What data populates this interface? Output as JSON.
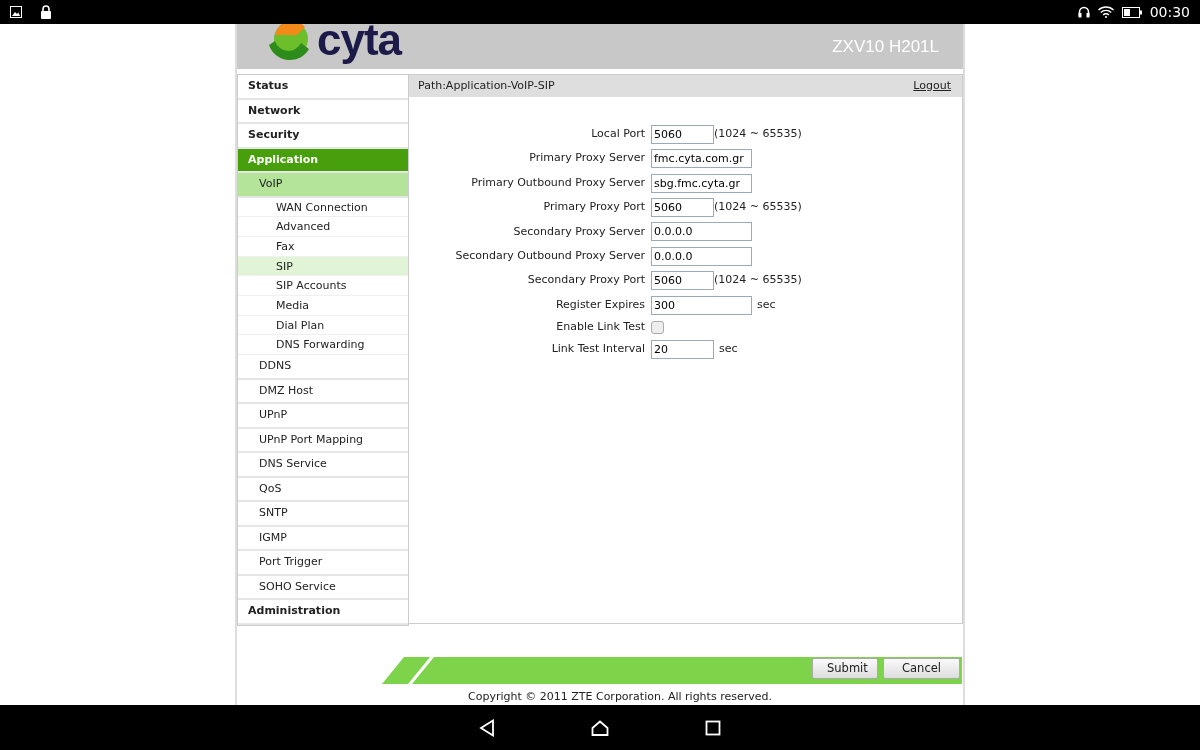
{
  "status_bar": {
    "time": "00:30"
  },
  "header": {
    "logo_text": "cyta",
    "model": "ZXV10 H201L"
  },
  "sidebar": {
    "items": [
      {
        "label": "Status",
        "selected": false
      },
      {
        "label": "Network",
        "selected": false
      },
      {
        "label": "Security",
        "selected": false
      },
      {
        "label": "Application",
        "selected": true,
        "children": [
          {
            "label": "VoIP",
            "selected": true,
            "children": [
              {
                "label": "WAN Connection",
                "selected": false
              },
              {
                "label": "Advanced",
                "selected": false
              },
              {
                "label": "Fax",
                "selected": false
              },
              {
                "label": "SIP",
                "selected": true
              },
              {
                "label": "SIP Accounts",
                "selected": false
              },
              {
                "label": "Media",
                "selected": false
              },
              {
                "label": "Dial Plan",
                "selected": false
              },
              {
                "label": "DNS Forwarding",
                "selected": false
              }
            ]
          },
          {
            "label": "DDNS",
            "selected": false
          },
          {
            "label": "DMZ Host",
            "selected": false
          },
          {
            "label": "UPnP",
            "selected": false
          },
          {
            "label": "UPnP Port Mapping",
            "selected": false
          },
          {
            "label": "DNS Service",
            "selected": false
          },
          {
            "label": "QoS",
            "selected": false
          },
          {
            "label": "SNTP",
            "selected": false
          },
          {
            "label": "IGMP",
            "selected": false
          },
          {
            "label": "Port Trigger",
            "selected": false
          },
          {
            "label": "SOHO Service",
            "selected": false
          }
        ]
      },
      {
        "label": "Administration",
        "selected": false
      }
    ]
  },
  "path_bar": {
    "path": "Path:Application-VoIP-SIP",
    "logout": "Logout"
  },
  "form": {
    "fields": [
      {
        "kind": "shortfield",
        "label": "Local Port",
        "value": "5060",
        "hint": "(1024 ~ 65535)"
      },
      {
        "kind": "longfield",
        "label": "Primary Proxy Server",
        "value": "fmc.cyta.com.gr"
      },
      {
        "kind": "longfield",
        "label": "Primary Outbound Proxy Server",
        "value": "sbg.fmc.cyta.gr"
      },
      {
        "kind": "shortfield",
        "label": "Primary Proxy Port",
        "value": "5060",
        "hint": "(1024 ~ 65535)"
      },
      {
        "kind": "longfield",
        "label": "Secondary Proxy Server",
        "value": "0.0.0.0"
      },
      {
        "kind": "longfield",
        "label": "Secondary Outbound Proxy Server",
        "value": "0.0.0.0"
      },
      {
        "kind": "shortfield",
        "label": "Secondary Proxy Port",
        "value": "5060",
        "hint": "(1024 ~ 65535)"
      },
      {
        "kind": "longfield",
        "label": "Register Expires",
        "value": "300",
        "unit": "sec"
      },
      {
        "kind": "checkbox",
        "label": "Enable Link Test",
        "checked": false
      },
      {
        "kind": "shortfield",
        "label": "Link Test Interval",
        "value": "20",
        "unit": "sec"
      }
    ]
  },
  "buttons": [
    "Submit",
    "Cancel"
  ],
  "footer": {
    "copyright": "Copyright © 2011 ZTE Corporation. All rights reserved."
  }
}
